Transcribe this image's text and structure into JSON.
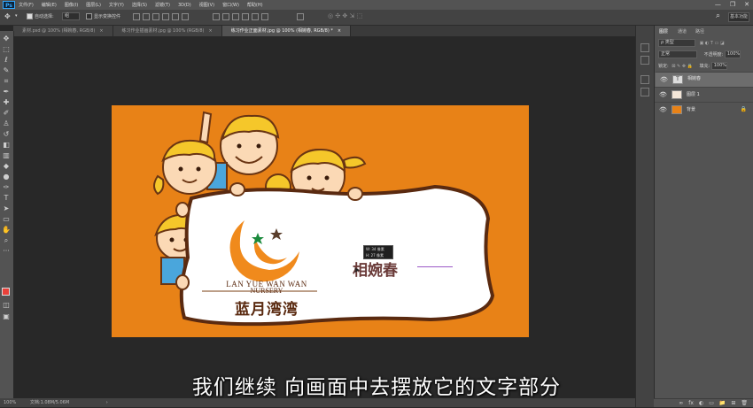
{
  "menu": {
    "logo": "Ps",
    "items": [
      "文件(F)",
      "编辑(E)",
      "图像(I)",
      "图层(L)",
      "文字(Y)",
      "选择(S)",
      "滤镜(T)",
      "3D(D)",
      "视图(V)",
      "窗口(W)",
      "帮助(H)"
    ],
    "window_controls": [
      "—",
      "❐",
      "✕"
    ]
  },
  "options": {
    "auto_select_label": "自动选择:",
    "auto_select_value": "组",
    "show_transform_label": "显示变换控件",
    "workspace": "基本功能"
  },
  "tabs": [
    {
      "label": "素材.psd @ 100% (相婉春, RGB/8)",
      "close": "×"
    },
    {
      "label": "练习作业插画素材.jpg @ 100% (RGB/8)",
      "close": "×"
    },
    {
      "label": "练习作业正面素材.jpg @ 100% (相婉春, RGB/8) *",
      "close": "×"
    }
  ],
  "canvas": {
    "logo_en_line1": "LAN YUE WAN WAN",
    "logo_en_line2": "NURSERY",
    "logo_cn": "蓝月湾湾",
    "text_layer": "相婉春",
    "tooltip_line1": "W: 34 像素",
    "tooltip_line2": "H: 27 像素"
  },
  "subtitle": "我们继续 向画面中去摆放它的文字部分",
  "status": {
    "zoom": "100%",
    "doc": "文档:1.08M/5.06M"
  },
  "layers_panel": {
    "tabs": [
      "图层",
      "通道",
      "路径"
    ],
    "filter_label": "ρ 类型",
    "blend_mode": "正常",
    "opacity_label": "不透明度:",
    "opacity_value": "100%",
    "lock_label": "锁定:",
    "fill_label": "填充:",
    "fill_value": "100%",
    "layers": [
      {
        "name": "相婉春",
        "thumb": "T",
        "selected": true
      },
      {
        "name": "图层 1",
        "thumb": "",
        "selected": false
      },
      {
        "name": "背景",
        "thumb": "",
        "selected": false,
        "lock": "🔒"
      }
    ],
    "footer_icons": [
      "fx",
      "◐",
      "▭",
      "📁",
      "⊞",
      "🗑"
    ]
  },
  "colors": {
    "artboard": "#e88217",
    "logo_orange": "#f08a1c",
    "foreground": "#e8413a"
  }
}
